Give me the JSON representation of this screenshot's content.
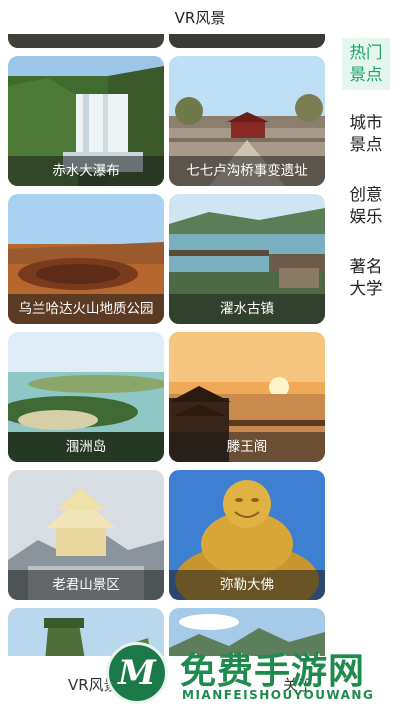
{
  "app_title": "VR风景",
  "grid": {
    "cards": [
      {
        "label": ""
      },
      {
        "label": ""
      },
      {
        "label": "赤水大瀑布"
      },
      {
        "label": "七七卢沟桥事变遗址"
      },
      {
        "label": "乌兰哈达火山地质公园"
      },
      {
        "label": "濯水古镇"
      },
      {
        "label": "涠洲岛"
      },
      {
        "label": "滕王阁"
      },
      {
        "label": "老君山景区"
      },
      {
        "label": "弥勒大佛"
      },
      {
        "label": ""
      },
      {
        "label": ""
      }
    ]
  },
  "sidebar": {
    "items": [
      {
        "line1": "热门",
        "line2": "景点"
      },
      {
        "line1": "城市",
        "line2": "景点"
      },
      {
        "line1": "创意",
        "line2": "娱乐"
      },
      {
        "line1": "著名",
        "line2": "大学"
      }
    ]
  },
  "bottom_nav": {
    "home_label": "VR风景",
    "about_label": "关于"
  },
  "watermark": {
    "logo_letter": "M",
    "title": "免费手游网",
    "subtitle": "MIANFEISHOUYOUWANG"
  }
}
